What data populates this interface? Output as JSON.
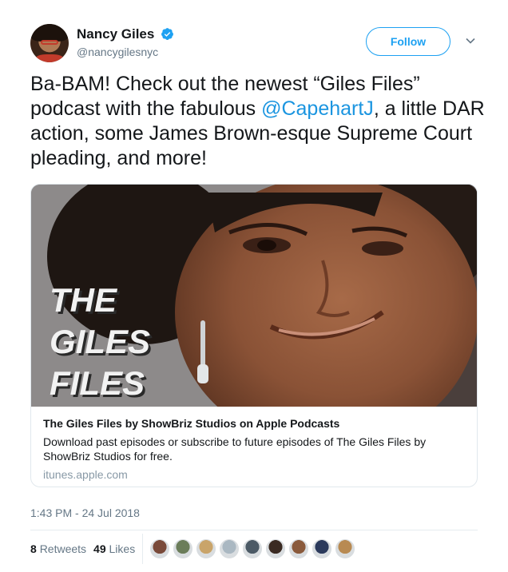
{
  "author": {
    "name": "Nancy Giles",
    "handle": "@nancygilesnyc",
    "verified": true
  },
  "follow_button": {
    "label": "Follow"
  },
  "tweet": {
    "text_before": "Ba-BAM! Check out the newest “Giles Files” podcast with the fabulous ",
    "mention": "@CapehartJ",
    "text_after": ", a little DAR action, some James Brown-esque Supreme Court pleading, and more!"
  },
  "card": {
    "image_text": [
      "THE",
      "GILES",
      "FILES"
    ],
    "title": "The Giles Files by ShowBriz Studios on Apple Podcasts",
    "description": "Download past episodes or subscribe to future episodes of The Giles Files by ShowBriz Studios for free.",
    "domain": "itunes.apple.com"
  },
  "timestamp": "1:43 PM - 24 Jul 2018",
  "stats": {
    "retweets_count": "8",
    "retweets_label": "Retweets",
    "likes_count": "49",
    "likes_label": "Likes"
  },
  "likers": [
    {
      "color": "#7a4a3a"
    },
    {
      "color": "#6b7d5a"
    },
    {
      "color": "#c9a46a"
    },
    {
      "color": "#aab8c2"
    },
    {
      "color": "#4c5a66"
    },
    {
      "color": "#3a2a22"
    },
    {
      "color": "#8a5a3c"
    },
    {
      "color": "#2b3a5c"
    },
    {
      "color": "#b88a52"
    }
  ],
  "colors": {
    "accent": "#1da1f2",
    "mention": "#1b95e0",
    "secondary_text": "#657786"
  }
}
